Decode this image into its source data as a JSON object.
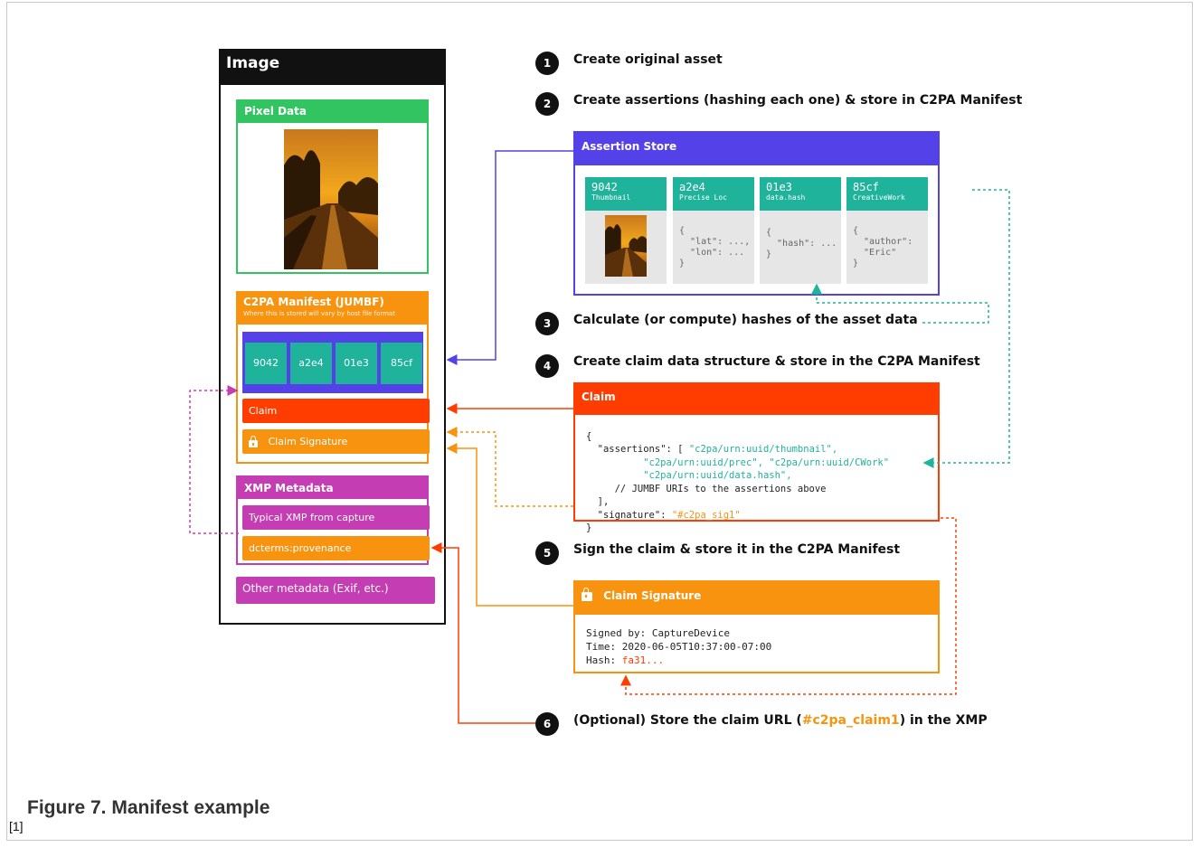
{
  "image_panel": {
    "title": "Image",
    "pixel_data": {
      "title": "Pixel Data"
    },
    "manifest": {
      "title": "C2PA Manifest (JUMBF)",
      "subtitle": "Where this is stored will vary by host file format",
      "tiles": [
        "9042",
        "a2e4",
        "01e3",
        "85cf"
      ],
      "claim_label": "Claim",
      "claim_signature_label": "Claim Signature"
    },
    "xmp": {
      "title": "XMP Metadata",
      "typical": "Typical XMP from capture",
      "provenance": "dcterms:provenance"
    },
    "other": "Other metadata (Exif, etc.)"
  },
  "steps": [
    {
      "num": "1",
      "text": "Create original asset"
    },
    {
      "num": "2",
      "text": "Create assertions (hashing each one) & store in C2PA Manifest"
    },
    {
      "num": "3",
      "text": "Calculate (or compute) hashes of the asset data"
    },
    {
      "num": "4",
      "text": "Create claim data structure & store in the C2PA Manifest"
    },
    {
      "num": "5",
      "text": "Sign the claim & store it in the C2PA Manifest"
    },
    {
      "num": "6",
      "text_before": "(Optional) Store the claim URL (",
      "text_highlight": "#c2pa_claim1",
      "text_after": ") in the XMP"
    }
  ],
  "assertion_store": {
    "title": "Assertion Store",
    "cards": [
      {
        "id": "9042",
        "label": "Thumbnail",
        "body": ""
      },
      {
        "id": "a2e4",
        "label": "Precise Loc",
        "body": "{\n  \"lat\": ...,\n  \"lon\": ...\n}"
      },
      {
        "id": "01e3",
        "label": "data.hash",
        "body": "{\n  \"hash\": ...\n}"
      },
      {
        "id": "85cf",
        "label": "CreativeWork",
        "body": "{\n  \"author\":\n  \"Eric\"\n}"
      }
    ]
  },
  "claim": {
    "title": "Claim",
    "line1": "{",
    "assertions_key": "\"assertions\": [ ",
    "uri1": "\"c2pa/urn:uuid/thumbnail\",",
    "uri2": "\"c2pa/urn:uuid/prec\", \"c2pa/urn:uuid/CWork\"",
    "uri3": "\"c2pa/urn:uuid/data.hash\",",
    "comment": "// JUMBF URIs to the assertions above",
    "close_bracket": "],",
    "signature_key": "\"signature\": ",
    "signature_value": "\"#c2pa_sig1\"",
    "line_end": "}"
  },
  "claim_signature": {
    "title": "Claim Signature",
    "signed_by": "Signed by: CaptureDevice",
    "time": "Time: 2020-06-05T10:37:00-07:00",
    "hash_label": "Hash: ",
    "hash_value": "fa31..."
  },
  "caption": "Figure 7.  Manifest example",
  "footnote": "[1]",
  "colors": {
    "green": "#33c462",
    "orange": "#f7930e",
    "purple": "#5442e8",
    "teal": "#1fb39c",
    "red": "#ff3d00",
    "magenta": "#c53db2"
  }
}
